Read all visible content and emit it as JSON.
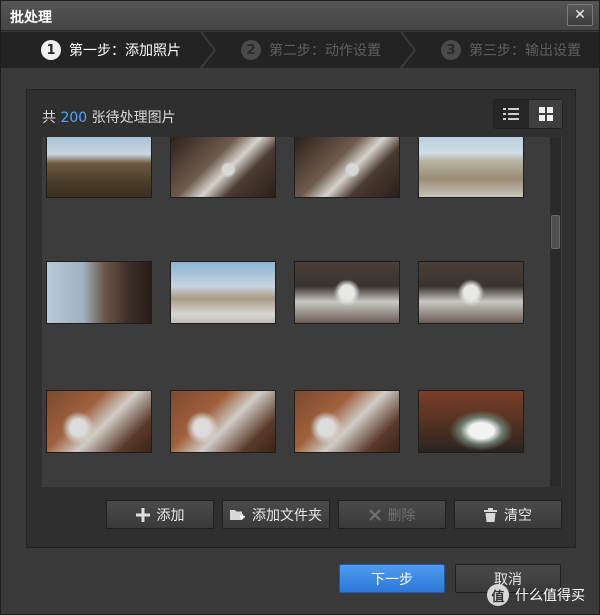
{
  "window": {
    "title": "批处理",
    "close_label": "✕"
  },
  "steps": [
    {
      "num": "1",
      "label": "第一步：添加照片",
      "state": "active"
    },
    {
      "num": "2",
      "label": "第二步：动作设置",
      "state": "inactive"
    },
    {
      "num": "3",
      "label": "第三步：输出设置",
      "state": "inactive"
    }
  ],
  "summary": {
    "prefix": "共",
    "count": "200",
    "suffix": "张待处理图片"
  },
  "view_toggle": {
    "options": [
      "list-view-icon",
      "grid-view-icon"
    ],
    "selected": "grid-view-icon"
  },
  "thumbnails": [
    {
      "subject": "bare-trees-sky"
    },
    {
      "subject": "snowy-branches-rock"
    },
    {
      "subject": "snowy-branches-rock"
    },
    {
      "subject": "frosted-grass-field"
    },
    {
      "subject": "mountain-road-cliff"
    },
    {
      "subject": "frosted-grass-sky"
    },
    {
      "subject": "snow-shrub-closeup"
    },
    {
      "subject": "snow-shrub-closeup"
    },
    {
      "subject": "snow-branches-red-rock"
    },
    {
      "subject": "snow-branches-red-rock"
    },
    {
      "subject": "snow-branches-red-rock"
    },
    {
      "subject": "snow-plant-macro"
    }
  ],
  "actions": {
    "add": "添加",
    "add_folder": "添加文件夹",
    "delete": "删除",
    "clear": "清空"
  },
  "footer": {
    "next": "下一步",
    "cancel": "取消"
  },
  "watermark": {
    "logo": "值",
    "text": "什么值得买"
  },
  "colors": {
    "accent": "#4da3ff",
    "primary_button": "#3a86e6",
    "background": "#3a3a3a"
  }
}
